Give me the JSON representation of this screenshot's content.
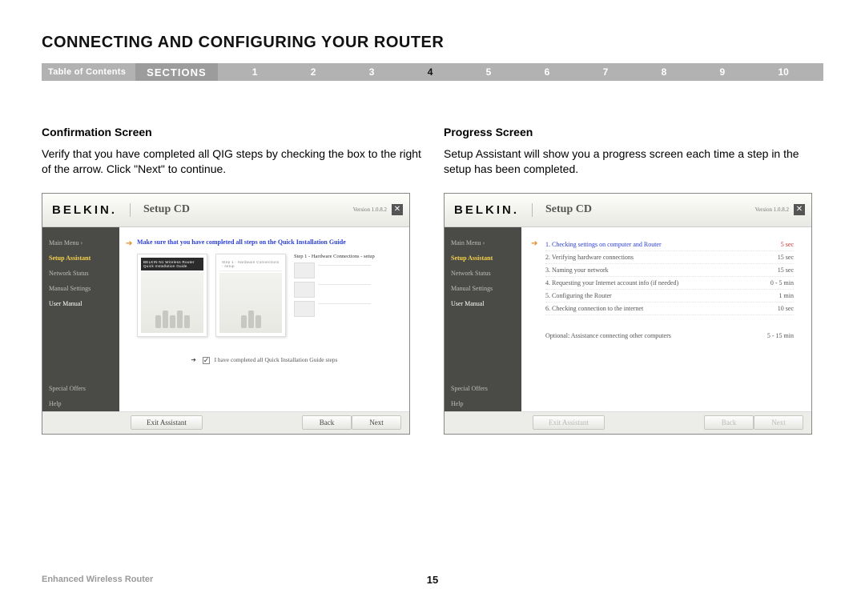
{
  "page": {
    "title": "CONNECTING AND CONFIGURING YOUR ROUTER",
    "toc_label": "Table of Contents",
    "sections_label": "SECTIONS",
    "section_numbers": [
      "1",
      "2",
      "3",
      "4",
      "5",
      "6",
      "7",
      "8",
      "9",
      "10"
    ],
    "active_section": "4",
    "footer_left": "Enhanced Wireless Router",
    "page_number": "15"
  },
  "left": {
    "heading": "Confirmation Screen",
    "body": "Verify that you have completed all QIG steps by checking the box to the right of the arrow. Click \"Next\" to continue."
  },
  "right": {
    "heading": "Progress Screen",
    "body": "Setup Assistant will show you a progress screen each time a step in the setup has been completed."
  },
  "mock": {
    "brand": "BELKIN.",
    "title": "Setup CD",
    "version": "Version 1.0.8.2",
    "close": "✕",
    "sidebar": {
      "main_menu": "Main Menu  ›",
      "setup_assistant": "Setup Assistant",
      "network_status": "Network Status",
      "manual_settings": "Manual Settings",
      "user_manual": "User Manual",
      "special_offers": "Special Offers",
      "help": "Help"
    },
    "footer": {
      "exit": "Exit Assistant",
      "back": "Back",
      "next": "Next"
    }
  },
  "confirm": {
    "instruction": "Make sure that you have completed all steps on the Quick Installation Guide",
    "card_head": "BELKIN  N1 Wireless Router   Quick Installation Guide",
    "steps_title": "Step 1 - Hardware Connections - setup",
    "checkbox_label": "I have completed all Quick Installation Guide steps"
  },
  "progress": {
    "rows": [
      {
        "label": "1. Checking settings on computer and Router",
        "time": "5 sec"
      },
      {
        "label": "2. Verifying hardware connections",
        "time": "15 sec"
      },
      {
        "label": "3. Naming your network",
        "time": "15 sec"
      },
      {
        "label": "4. Requesting your Internet account info (if needed)",
        "time": "0 - 5 min"
      },
      {
        "label": "5. Configuring the Router",
        "time": "1 min"
      },
      {
        "label": "6. Checking connection to the internet",
        "time": "10 sec"
      }
    ],
    "optional": {
      "label": "Optional: Assistance connecting other computers",
      "time": "5 - 15 min"
    }
  }
}
